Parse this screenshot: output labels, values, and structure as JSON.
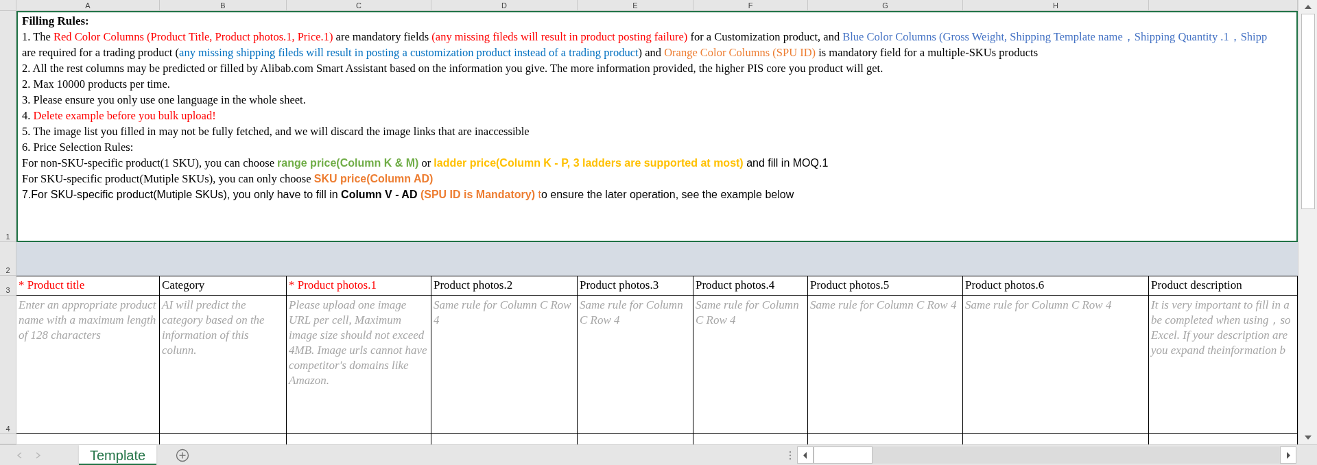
{
  "columns": [
    "A",
    "B",
    "C",
    "D",
    "E",
    "F",
    "G",
    "H"
  ],
  "rules": {
    "title": "Filling Rules:",
    "lines": [
      [
        {
          "kind": "text",
          "text": "1. The "
        },
        {
          "kind": "red",
          "text": "Red Color Columns (Product Title, Product photos.1, Price.1)"
        },
        {
          "kind": "text",
          "text": " are mandatory fields "
        },
        {
          "kind": "red",
          "text": "(any missing fileds will result in product posting failure)"
        },
        {
          "kind": "text",
          "text": " for a Customization product, and "
        },
        {
          "kind": "blue",
          "text": "Blue Color Columns (Gross Weight, Shipping Template name，Shipping Quantity .1，Shipp"
        }
      ],
      [
        {
          "kind": "text",
          "text": "are required for a trading product ("
        },
        {
          "kind": "blue_dark",
          "text": "any missing shipping fileds will result in posting a customization product instead of a trading product"
        },
        {
          "kind": "text",
          "text": ") and "
        },
        {
          "kind": "orange",
          "text": "Orange Color Columns (SPU ID)"
        },
        {
          "kind": "text",
          "text": " is mandatory field for a multiple-SKUs products"
        }
      ],
      [
        {
          "kind": "text",
          "text": "2. All the rest columns may be predicted or filled by Alibab.com Smart Assistant based on the information you give. The more information provided, the higher PIS core you product will get."
        }
      ],
      [
        {
          "kind": "text",
          "text": "2. Max 10000 products per time."
        }
      ],
      [
        {
          "kind": "text",
          "text": "3. Please ensure you only use one language in the whole sheet."
        }
      ],
      [
        {
          "kind": "text",
          "text": "4. "
        },
        {
          "kind": "red",
          "text": "Delete example before you bulk upload!"
        }
      ],
      [
        {
          "kind": "text",
          "text": "5. The image list you filled in may not be fully fetched, and we will discard the image links that are inaccessible"
        }
      ],
      [
        {
          "kind": "text",
          "text": "6. Price Selection Rules:"
        }
      ],
      [
        {
          "kind": "text",
          "text": "For non-SKU-specific product(1 SKU), you can choose "
        },
        {
          "kind": "green_bold",
          "text": "range price(Column K & M)"
        },
        {
          "kind": "text",
          "text": " or "
        },
        {
          "kind": "yellow_bold",
          "text": "ladder price(Column K - P, 3 ladders are supported at most)"
        },
        {
          "kind": "sans",
          "text": " and fill in MOQ.1"
        }
      ],
      [
        {
          "kind": "text",
          "text": "For SKU-specific product(Mutiple SKUs), you can only choose "
        },
        {
          "kind": "orange_bold",
          "text": "SKU price(Column AD)"
        }
      ],
      [
        {
          "kind": "sans",
          "text": "7.For SKU-specific product(Mutiple SKUs), you only have to fill in "
        },
        {
          "kind": "sans_bold",
          "text": "Column V - AD"
        },
        {
          "kind": "orange_bold",
          "text": " (SPU ID is Mandatory)"
        },
        {
          "kind": "orange_sans",
          "text": " t"
        },
        {
          "kind": "sans",
          "text": "o ensure the later operation, see the example below"
        }
      ]
    ]
  },
  "table": {
    "headers": [
      {
        "text": "* Product title",
        "required": true
      },
      {
        "text": "Category",
        "required": false
      },
      {
        "text": "* Product photos.1",
        "required": true
      },
      {
        "text": "Product photos.2",
        "required": false
      },
      {
        "text": "Product photos.3",
        "required": false
      },
      {
        "text": "Product photos.4",
        "required": false
      },
      {
        "text": "Product photos.5",
        "required": false
      },
      {
        "text": "Product photos.6",
        "required": false
      },
      {
        "text": "Product description",
        "required": false
      }
    ],
    "hints": [
      "Enter an appropriate product name with a maximum length of 128 characters",
      "AI will predict the category based on the information of this colunn.",
      "Please upload one image URL per cell, Maximum image size should not exceed 4MB. Image urls cannot have competitor's domains like Amazon.",
      "Same rule for Column C Row 4",
      "Same rule for Column C Row 4",
      "Same rule for Column C Row 4",
      "Same rule for Column C Row 4",
      "Same rule for Column C Row 4",
      "It is very important to fill in a\nbe completed when using，so\nExcel. If your description are\nyou expand theinformation b"
    ]
  },
  "row_numbers": [
    "1",
    "2",
    "3",
    "4"
  ],
  "sheet_tabs": [
    {
      "label": "Template",
      "selected": true
    }
  ]
}
